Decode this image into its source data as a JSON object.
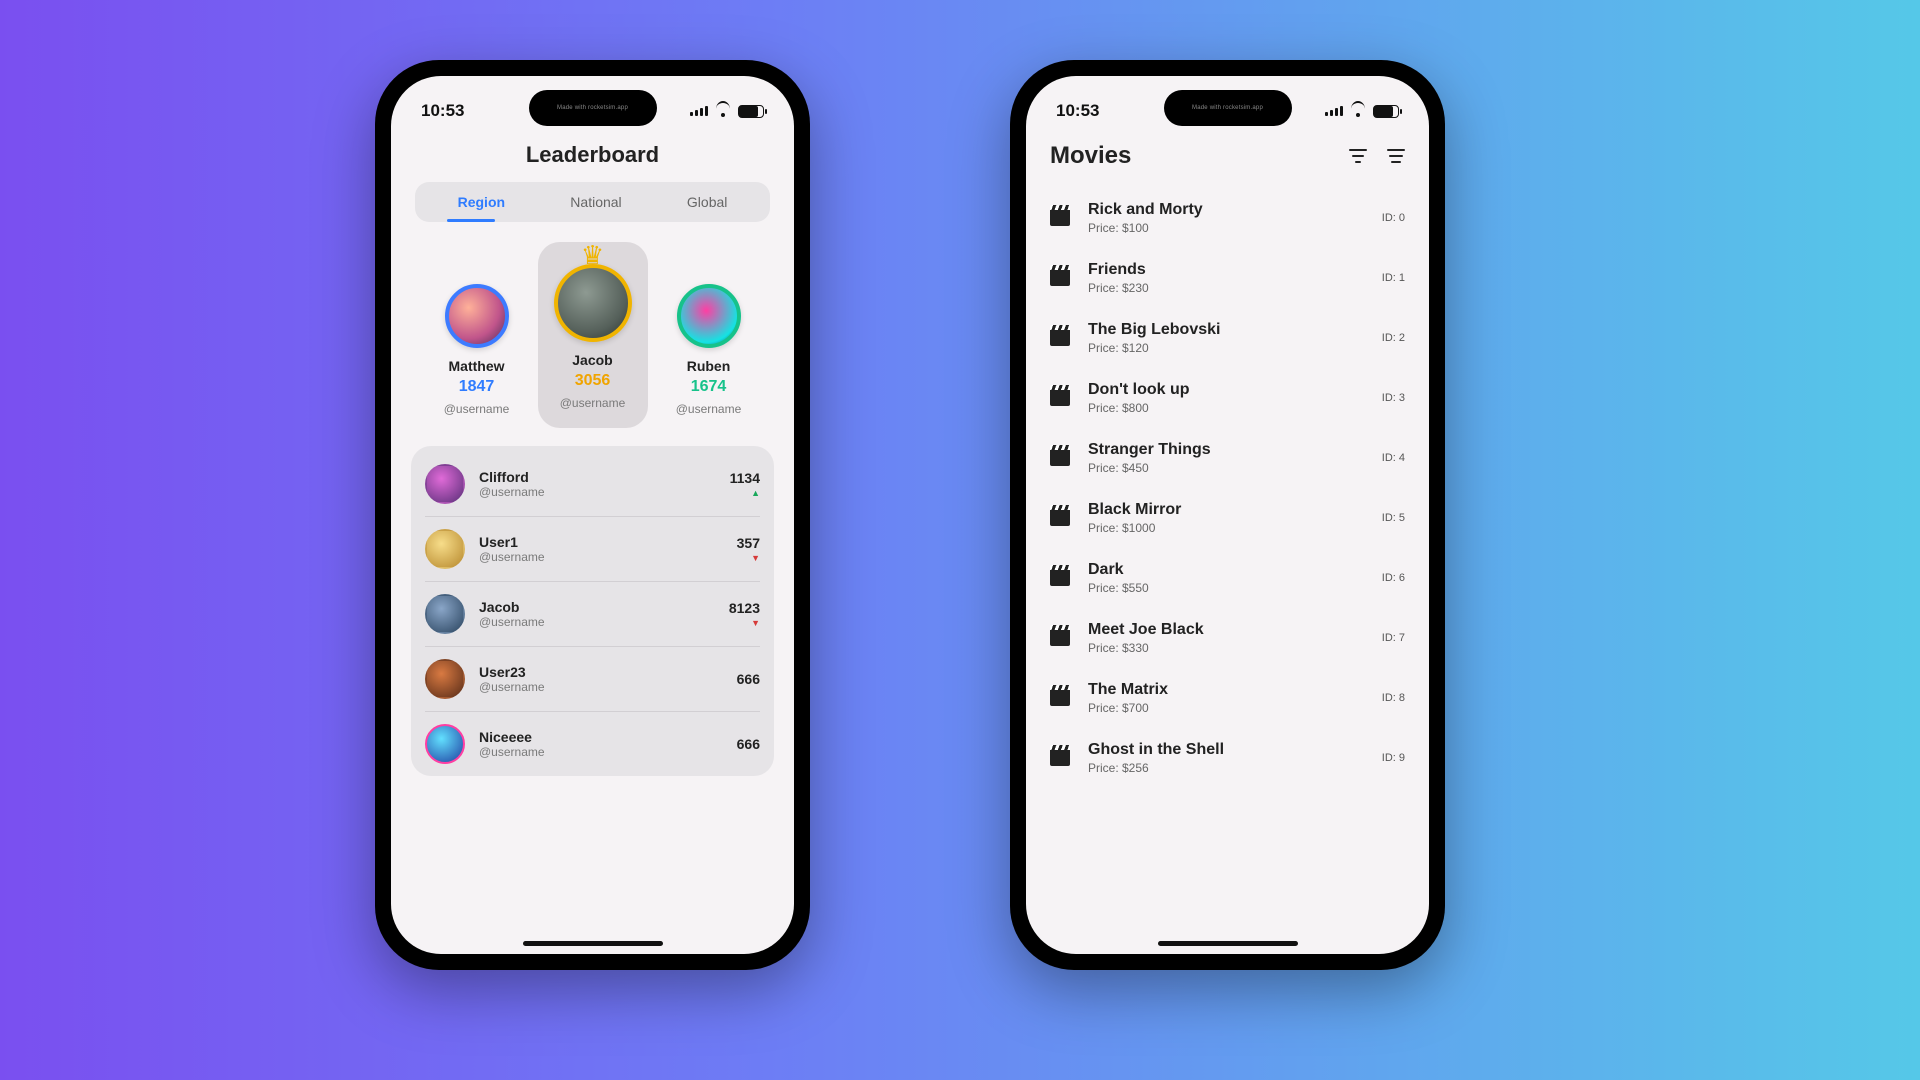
{
  "status": {
    "time": "10:53",
    "madeby": "Made with rocketsim.app"
  },
  "leaderboard": {
    "title": "Leaderboard",
    "tabs": {
      "region": "Region",
      "national": "National",
      "global": "Global"
    },
    "podium": {
      "left": {
        "name": "Matthew",
        "score": "1847",
        "handle": "@username"
      },
      "center": {
        "name": "Jacob",
        "score": "3056",
        "handle": "@username"
      },
      "right": {
        "name": "Ruben",
        "score": "1674",
        "handle": "@username"
      }
    },
    "rows": [
      {
        "name": "Clifford",
        "handle": "@username",
        "score": "1134",
        "trend": "up"
      },
      {
        "name": "User1",
        "handle": "@username",
        "score": "357",
        "trend": "down"
      },
      {
        "name": "Jacob",
        "handle": "@username",
        "score": "8123",
        "trend": "down"
      },
      {
        "name": "User23",
        "handle": "@username",
        "score": "666",
        "trend": ""
      },
      {
        "name": "Niceeee",
        "handle": "@username",
        "score": "666",
        "trend": ""
      }
    ]
  },
  "movies": {
    "title": "Movies",
    "id_prefix": "ID: ",
    "price_prefix": "Price: ",
    "items": [
      {
        "title": "Rick and Morty",
        "price": "$100",
        "id": "0"
      },
      {
        "title": "Friends",
        "price": "$230",
        "id": "1"
      },
      {
        "title": "The Big Lebovski",
        "price": "$120",
        "id": "2"
      },
      {
        "title": "Don't look up",
        "price": "$800",
        "id": "3"
      },
      {
        "title": "Stranger Things",
        "price": "$450",
        "id": "4"
      },
      {
        "title": "Black Mirror",
        "price": "$1000",
        "id": "5"
      },
      {
        "title": "Dark",
        "price": "$550",
        "id": "6"
      },
      {
        "title": "Meet Joe Black",
        "price": "$330",
        "id": "7"
      },
      {
        "title": "The Matrix",
        "price": "$700",
        "id": "8"
      },
      {
        "title": "Ghost in the Shell",
        "price": "$256",
        "id": "9"
      }
    ]
  }
}
